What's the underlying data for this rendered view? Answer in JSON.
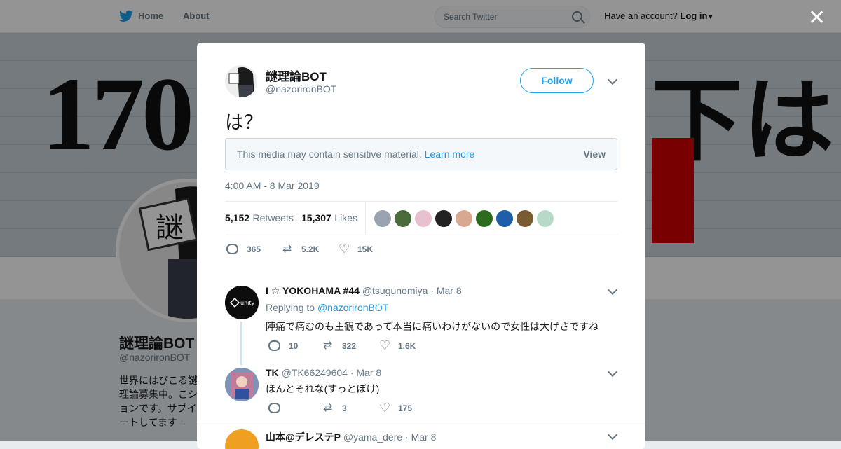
{
  "nav": {
    "home_label": "Home",
    "about_label": "About",
    "search_placeholder": "Search Twitter",
    "account_prompt": "Have an account?",
    "login_label": "Log in"
  },
  "background_profile": {
    "banner_text_left": "170",
    "banner_text_right": "下は",
    "name": "謎理論BOT",
    "handle": "@nazoriron​BOT",
    "bio": "世界にはびこる謎理論募集中。こションです。サブイートしてます→"
  },
  "tweet": {
    "author_name": "謎理論BOT",
    "author_handle": "@nazoriron​BOT",
    "follow_label": "Follow",
    "text": "は？",
    "sensitive_message": "This media may contain sensitive material.",
    "learn_more_label": "Learn more",
    "view_label": "View",
    "timestamp": "4:00 AM - 8 Mar 2019",
    "retweets_count": "5,152",
    "retweets_label": "Retweets",
    "likes_count": "15,307",
    "likes_label": "Likes",
    "actions": {
      "replies": "365",
      "retweets": "5.2K",
      "likes": "15K"
    },
    "liker_colors": [
      "#9aa4b0",
      "#4a6b3a",
      "#e8c0d0",
      "#222222",
      "#d8a890",
      "#2d6b1f",
      "#1f5fa8",
      "#7a5a30",
      "#b8d8c8"
    ]
  },
  "replies": [
    {
      "name": "I ☆ YOKOHAMA #44",
      "handle": "@tsugunomiya",
      "date": "· Mar 8",
      "replying_prefix": "Replying to",
      "replying_to": "@nazoriron​BOT",
      "text": "陣痛で痛むのも主観であって本当に痛いわけがないので女性は大げさですね",
      "replies": "10",
      "retweets": "322",
      "likes": "1.6K"
    },
    {
      "name": "TK",
      "handle": "@TK66249604",
      "date": "· Mar 8",
      "text": "ほんとそれな(すっとぼけ)",
      "replies": "",
      "retweets": "3",
      "likes": "175"
    },
    {
      "name": "山本@デレステP",
      "handle": "@yama_dere",
      "date": "· Mar 8"
    }
  ]
}
